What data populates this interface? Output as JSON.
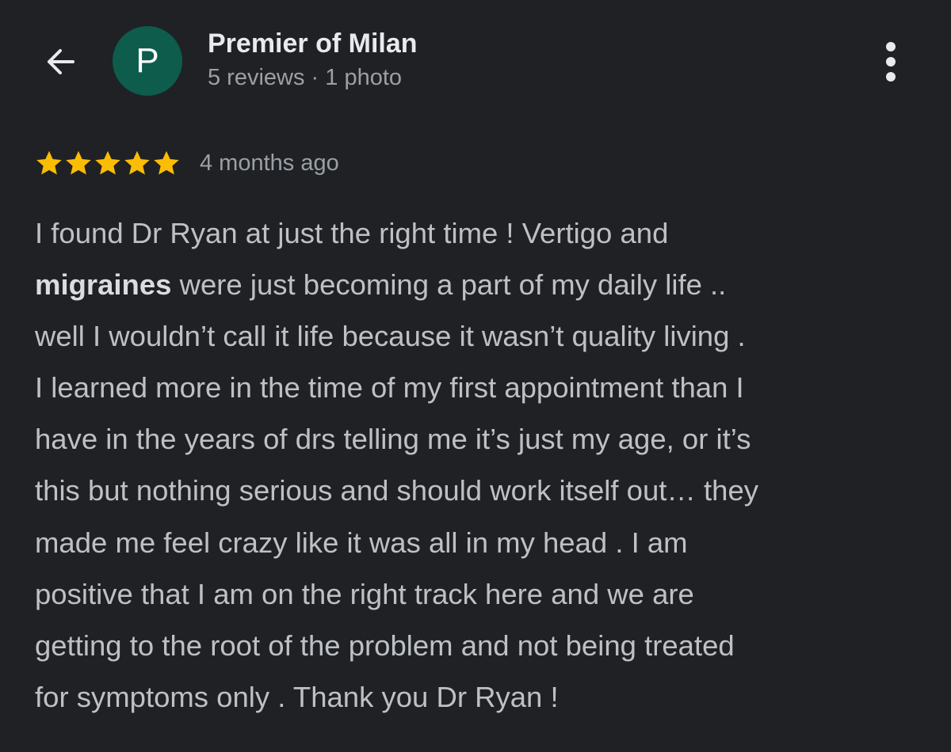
{
  "header": {
    "back_icon": "arrow-left-icon",
    "avatar_letter": "P",
    "avatar_color": "#0d5c4c",
    "reviewer_name": "Premier of Milan",
    "reviewer_meta": "5 reviews · 1 photo",
    "more_icon": "more-vertical-icon"
  },
  "review": {
    "rating": 5,
    "rating_max": 5,
    "star_color": "#fbbc04",
    "time_ago": "4 months ago",
    "lines": {
      "l1": "I found Dr Ryan at just the right time ! Vertigo and",
      "l2_highlight": "migraines",
      "l2_rest": " were just becoming a part of my daily life ..",
      "l3": "well I wouldn’t call it life because it wasn’t quality living .",
      "l4": "I learned more in the time of my first appointment than I",
      "l5": "have in the years of drs telling me it’s just my age, or it’s",
      "l6": "this but nothing serious and should work itself out… they",
      "l7": "made me feel crazy like it was all in my head . I am",
      "l8": "positive that I am on the right track here and we are",
      "l9": "getting to the root of the problem and not being treated",
      "l10": "for symptoms only . Thank you Dr Ryan !"
    }
  }
}
